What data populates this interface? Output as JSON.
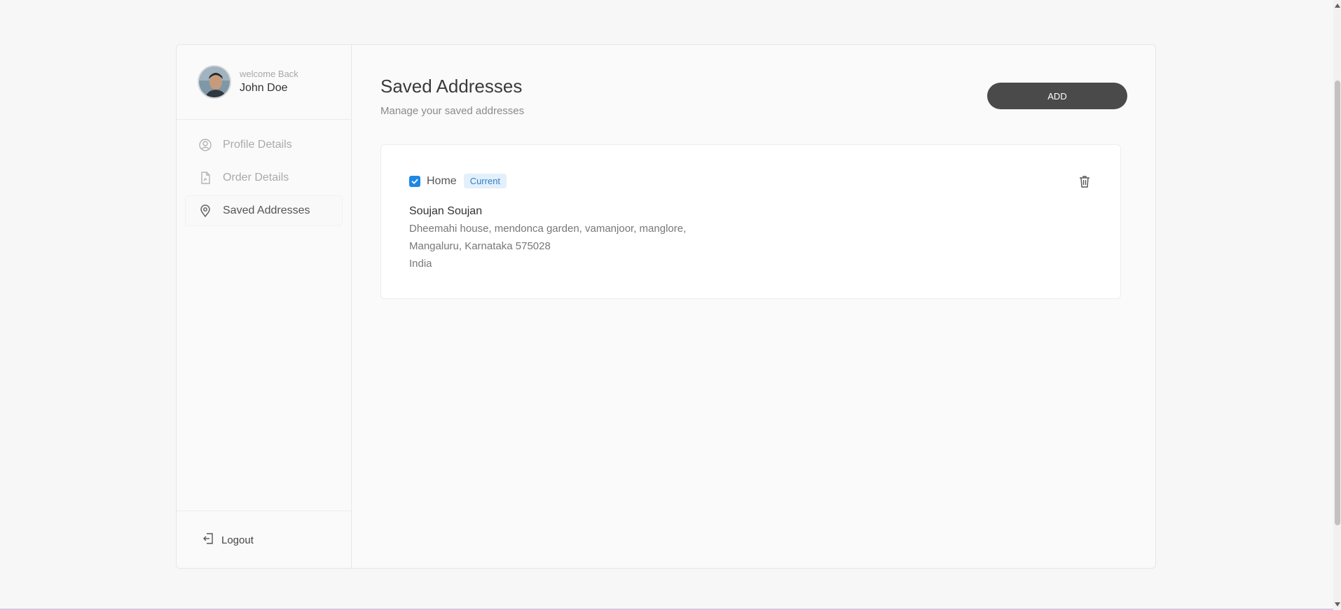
{
  "sidebar": {
    "welcome_text": "welcome Back",
    "username": "John Doe",
    "nav": [
      {
        "label": "Profile Details",
        "icon": "user-circle-icon",
        "active": false
      },
      {
        "label": "Order Details",
        "icon": "document-icon",
        "active": false
      },
      {
        "label": "Saved Addresses",
        "icon": "map-pin-icon",
        "active": true
      }
    ],
    "logout_label": "Logout"
  },
  "main": {
    "title": "Saved Addresses",
    "subtitle": "Manage your saved addresses",
    "add_button_label": "ADD",
    "address": {
      "type": "Home",
      "badge": "Current",
      "checked": true,
      "name": "Soujan Soujan",
      "line1": "Dheemahi house, mendonca garden, vamanjoor, manglore,",
      "line2": "Mangaluru, Karnataka 575028",
      "country": "India"
    }
  },
  "colors": {
    "accent": "#1e88e5",
    "button_bg": "#4a4a4a",
    "badge_bg": "#e3f0fb",
    "badge_text": "#2f7fc8"
  }
}
